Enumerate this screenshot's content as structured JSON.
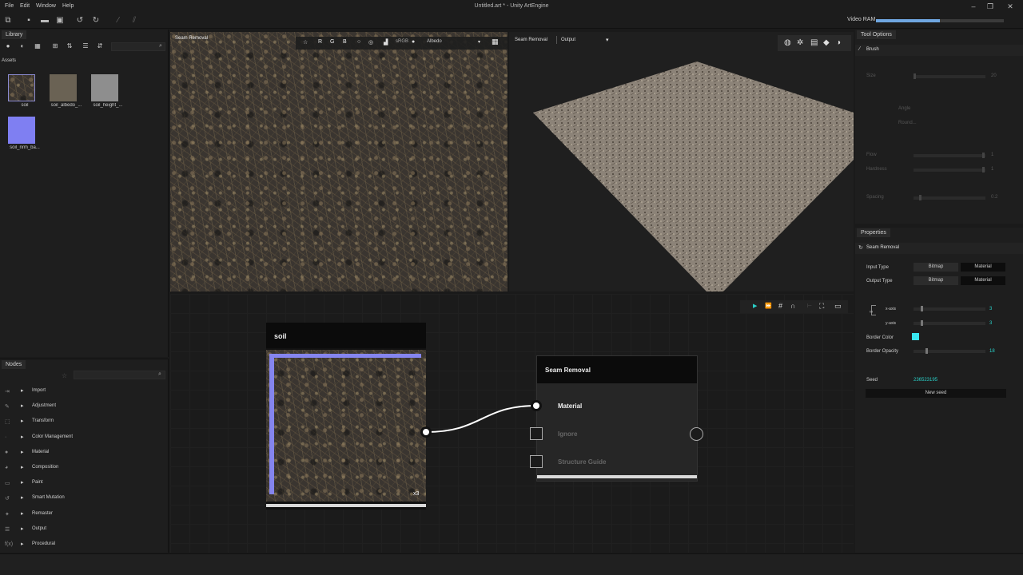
{
  "menu": [
    "File",
    "Edit",
    "Window",
    "Help"
  ],
  "window_title": "Untitled.art * - Unity ArtEngine",
  "vram": {
    "label": "Video RAM",
    "fill": 0.5
  },
  "library": {
    "tab": "Library",
    "section": "Assets",
    "assets": [
      {
        "label": "soil"
      },
      {
        "label": "soil_albedo_..."
      },
      {
        "label": "soil_height_..."
      },
      {
        "label": "soil_nrm_ba..."
      }
    ]
  },
  "nodes_panel": {
    "tab": "Nodes",
    "categories": [
      "Import",
      "Adjustment",
      "Transform",
      "Color Management",
      "Material",
      "Composition",
      "Paint",
      "Smart Mutation",
      "Remaster",
      "Output",
      "Procedural"
    ]
  },
  "view2d": {
    "label": "Seam Removal",
    "channels": [
      "R",
      "G",
      "B"
    ],
    "colorspace": "sRGB",
    "map": "Albedo"
  },
  "view3d": {
    "node": "Seam Removal",
    "mode": "Output"
  },
  "graph": {
    "soil_node": {
      "title": "soil",
      "badge": "x3"
    },
    "seam_node": {
      "title": "Seam Removal",
      "inputs": [
        "Material",
        "Ignore",
        "Structure Guide"
      ]
    }
  },
  "tool_options": {
    "tab": "Tool Options",
    "tool": "Brush",
    "size_label": "Size",
    "size_value": "20",
    "angle_label": "Angle",
    "round_label": "Round...",
    "flow_label": "Flow",
    "flow_value": "1",
    "hardness_label": "Hardness",
    "hardness_value": "1",
    "spacing_label": "Spacing",
    "spacing_value": "0.2"
  },
  "properties": {
    "tab": "Properties",
    "node": "Seam Removal",
    "input_type_label": "Input Type",
    "output_type_label": "Output Type",
    "opt_bitmap": "Bitmap",
    "opt_material": "Material",
    "x_axis_label": "x-axis",
    "x_axis_value": "3",
    "y_axis_label": "y-axis",
    "y_axis_value": "3",
    "border_color_label": "Border Color",
    "border_color": "#39e6f0",
    "border_opacity_label": "Border Opacity",
    "border_opacity_value": "18",
    "seed_label": "Seed",
    "seed_value": "236523195",
    "new_seed": "New seed"
  }
}
